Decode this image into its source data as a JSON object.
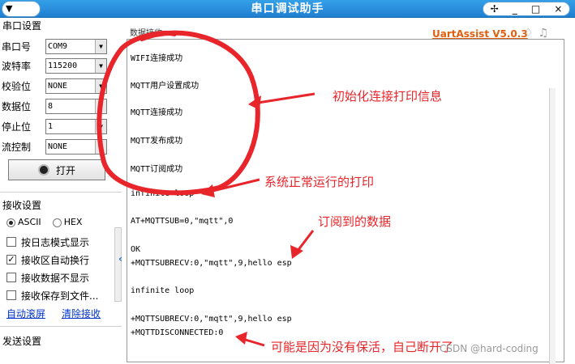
{
  "window": {
    "title": "串口调试助手",
    "menu_label": "▼",
    "controls": [
      "✢",
      "_",
      "□",
      "×"
    ]
  },
  "serial_settings": {
    "group_title": "串口设置",
    "port_label": "串口号",
    "port_value": "COM9",
    "baud_label": "波特率",
    "baud_value": "115200",
    "parity_label": "校验位",
    "parity_value": "NONE",
    "databits_label": "数据位",
    "databits_value": "8",
    "stopbits_label": "停止位",
    "stopbits_value": "1",
    "flow_label": "流控制",
    "flow_value": "NONE",
    "open_button": "打开"
  },
  "recv_settings": {
    "group_title": "接收设置",
    "ascii": "ASCII",
    "hex": "HEX",
    "opt_log_mode": "按日志模式显示",
    "opt_auto_wrap": "接收区自动换行",
    "opt_hide": "接收数据不显示",
    "opt_save": "接收保存到文件...",
    "link_autoscroll": "自动滚屏",
    "link_clear": "清除接收"
  },
  "send_settings": {
    "group_title": "发送设置"
  },
  "recv_panel": {
    "tab_label": "数据接收",
    "brand": "UartAssist V5.0.3",
    "lines": [
      "WIFI连接成功",
      "MQTT用户设置成功",
      "MQTT连接成功",
      "MQTT发布成功",
      "MQTT订阅成功",
      "infinite loop",
      "AT+MQTTSUB=0,\"mqtt\",0",
      "OK",
      "+MQTTSUBRECV:0,\"mqtt\",9,hello esp",
      "infinite loop",
      "+MQTTSUBRECV:0,\"mqtt\",9,hello esp",
      "+MQTTDISCONNECTED:0"
    ]
  },
  "annotations": {
    "init_info": "初始化连接打印信息",
    "normal_run": "系统正常运行的打印",
    "subscribed": "订阅到的数据",
    "disconnect": "可能是因为没有保活，自己断开了"
  },
  "watermark": "CSDN @hard-coding",
  "colors": {
    "titlebar": "#1f7fd0",
    "annotation": "#e8252a",
    "brand": "#e06010"
  }
}
